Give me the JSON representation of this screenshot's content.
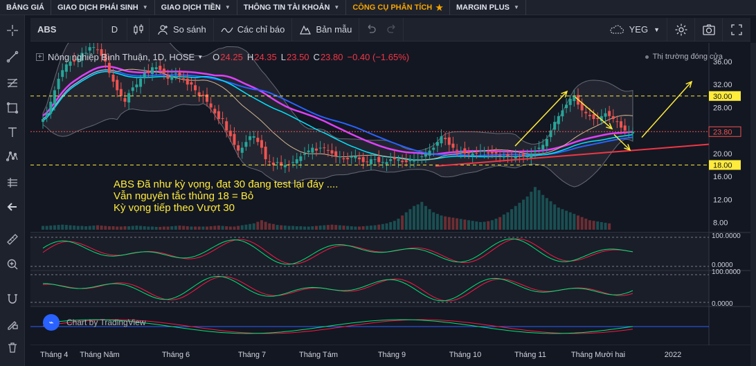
{
  "nav": [
    {
      "label": "BẢNG GIÁ",
      "dropdown": false,
      "active": false
    },
    {
      "label": "GIAO DỊCH PHÁI SINH",
      "dropdown": true,
      "active": false
    },
    {
      "label": "GIAO DỊCH TIỀN",
      "dropdown": true,
      "active": false
    },
    {
      "label": "THÔNG TIN TÀI KHOẢN",
      "dropdown": true,
      "active": false
    },
    {
      "label": "CÔNG CỤ PHÂN TÍCH",
      "dropdown": false,
      "active": true
    },
    {
      "label": "MARGIN PLUS",
      "dropdown": true,
      "active": false
    }
  ],
  "toolbar": {
    "symbol": "ABS",
    "interval": "D",
    "compare_label": "So sánh",
    "indicators_label": "Các chỉ báo",
    "templates_label": "Bản mẫu",
    "cloud_label": "YEG"
  },
  "left_tools": [
    "crosshair-icon",
    "trend-line-icon",
    "fib-icon",
    "rectangle-icon",
    "text-icon",
    "pattern-icon",
    "forecast-icon",
    "back-arrow-icon",
    "ruler-icon",
    "zoom-icon",
    "magnet-icon",
    "lock-draw-icon",
    "trash-icon"
  ],
  "legend": {
    "title": "Nông nghiệp Bình Thuận, 1D, HOSE",
    "o_key": "O",
    "o_val": "24.25",
    "h_key": "H",
    "h_val": "24.35",
    "l_key": "L",
    "l_val": "23.50",
    "c_key": "C",
    "c_val": "23.80",
    "change": "−0.40 (−1.65%)"
  },
  "market_status": "Thị trường đóng cửa",
  "annotation": [
    "ABS Đã như kỳ vọng, đạt 30 đang test lại đáy ....",
    "Vẫn nguyên tắc thủng 18 = Bỏ",
    "Kỳ vọng tiếp theo Vượt 30"
  ],
  "watermark": "Chart by TradingView",
  "colors": {
    "up": "#26a69a",
    "down": "#ef5350",
    "accent": "#f7a600",
    "annotation": "#ffeb3b",
    "label_bg": "#ffeb3b"
  },
  "chart_data": {
    "type": "candlestick",
    "price_axis": {
      "ticks": [
        "36.00",
        "32.00",
        "28.00",
        "24.00",
        "20.00",
        "16.00",
        "12.00",
        "8.00"
      ],
      "tick_values": [
        36,
        32,
        28,
        24,
        20,
        16,
        12,
        8
      ],
      "range": [
        6.5,
        39
      ]
    },
    "price_labels": [
      {
        "text": "30.00",
        "value": 30,
        "style": "yellow"
      },
      {
        "text": "23.80",
        "value": 23.8,
        "style": "red"
      },
      {
        "text": "18.00",
        "value": 18,
        "style": "yellow"
      }
    ],
    "horizontal_lines": [
      30,
      23.8,
      18
    ],
    "x_axis_labels": [
      "Tháng 4",
      "Tháng Năm",
      "Tháng 6",
      "Tháng 7",
      "Tháng Tám",
      "Tháng 9",
      "Tháng 10",
      "Tháng 11",
      "Tháng Mười hai",
      "2022"
    ],
    "x_axis_positions": [
      0.0,
      0.5,
      1.0,
      1.5,
      2.0,
      2.5,
      3.0,
      3.5,
      4.0,
      4.5
    ],
    "close_series": [
      26,
      27,
      29,
      31,
      33,
      34.5,
      35.5,
      36,
      36,
      36.5,
      37.5,
      37.5,
      38.5,
      38.5,
      38,
      37,
      36,
      34,
      32.5,
      31,
      30,
      29,
      30.5,
      31.5,
      32,
      33,
      34,
      34,
      35,
      35,
      34.5,
      34,
      33,
      33.5,
      34,
      33.5,
      33,
      32,
      32,
      31,
      30,
      30,
      29,
      28,
      27,
      26,
      26,
      24,
      23,
      21.5,
      20.5,
      21,
      22,
      23,
      23,
      22,
      21,
      19,
      18.5,
      18,
      18.5,
      18,
      18,
      18,
      18.5,
      19,
      19.5,
      20,
      20.5,
      21,
      20.5,
      21,
      21,
      20.5,
      20,
      19.5,
      19.5,
      19,
      19,
      19.5,
      19.5,
      19,
      18.5,
      18.5,
      19,
      19,
      18.5,
      18.5,
      18.5,
      19,
      19,
      19,
      18.5,
      18.5,
      19,
      19,
      19,
      19.5,
      20,
      20.5,
      21,
      22,
      23,
      22.5,
      21.5,
      21,
      20.5,
      20.5,
      20,
      20,
      20,
      20,
      20.5,
      20.5,
      20,
      20,
      20,
      19.5,
      19.5,
      19.5,
      19.5,
      19.5,
      19.5,
      19.5,
      19.5,
      20,
      20.5,
      21,
      21.5,
      22.5,
      24,
      25.5,
      26.5,
      27.5,
      28.5,
      29.5,
      30,
      28.5,
      27.5,
      27,
      26.5,
      26,
      26,
      26.5,
      27,
      26.5,
      26,
      25.5,
      24.5,
      24,
      23.8,
      23.8
    ],
    "volume_series": [
      1.2,
      1.2,
      1.3,
      1.4,
      1.5,
      1.6,
      1.5,
      1.4,
      1.3,
      1.2,
      1.2,
      1.1,
      1.2,
      1.3,
      1.4,
      1.3,
      1.2,
      1.1,
      1.1,
      1.0,
      1.0,
      1.1,
      1.1,
      1.2,
      1.3,
      1.2,
      1.1,
      1.0,
      1.0,
      0.9,
      0.9,
      1.0,
      1.0,
      1.1,
      1.2,
      1.3,
      1.2,
      1.1,
      1.0,
      1.0,
      1.0,
      1.0,
      1.0,
      1.1,
      1.2,
      1.3,
      1.2,
      1.1,
      1.0,
      1.0,
      1.2,
      1.4,
      1.6,
      1.8,
      2.0,
      2.5,
      3.0,
      2.5,
      2.0,
      1.8,
      1.5,
      1.4,
      1.3,
      1.2,
      1.2,
      1.1,
      1.1,
      1.0,
      1.0,
      1.1,
      1.2,
      1.3,
      1.4,
      1.5,
      1.6,
      1.5,
      1.4,
      1.3,
      1.2,
      1.1,
      1.0,
      1.0,
      1.1,
      1.2,
      1.3,
      1.4,
      1.6,
      1.8,
      2.0,
      2.4,
      2.8,
      3.5,
      4.5,
      5.5,
      6.5,
      7.5,
      8.0,
      8.8,
      7.5,
      6.5,
      5.5,
      5.0,
      4.5,
      4.2,
      4.0,
      3.8,
      3.6,
      3.4,
      3.2,
      3.0,
      2.8,
      2.6,
      2.4,
      2.5,
      2.7,
      3.0,
      3.5,
      4.0,
      4.8,
      5.5,
      6.5,
      7.5,
      8.5,
      9.5,
      10.5,
      12,
      13.5,
      12.5,
      11,
      10,
      9,
      8,
      7,
      6.5,
      6,
      5.5,
      5,
      4.5,
      4,
      3.5,
      3,
      2.8,
      2.6,
      2.4,
      2.2,
      2.0
    ]
  }
}
